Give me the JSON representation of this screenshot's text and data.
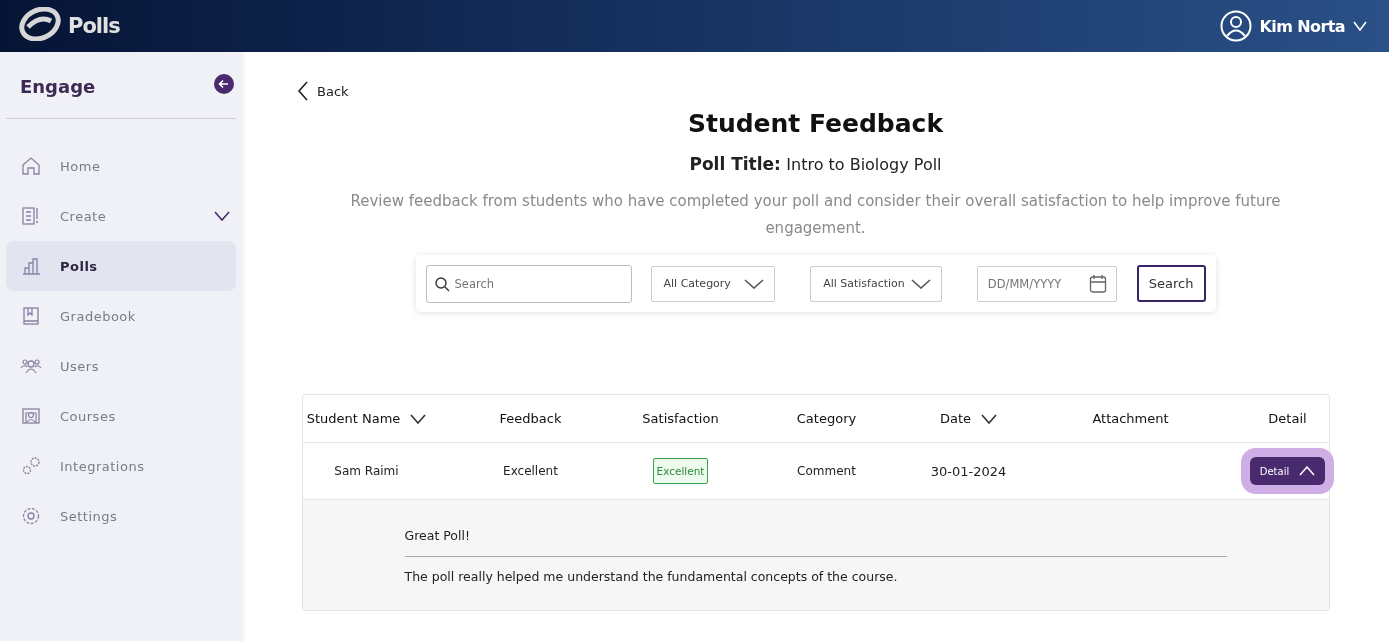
{
  "top_bar": {
    "brand": "Polls",
    "user": "Kim Norta"
  },
  "sidebar": {
    "title": "Engage",
    "items": [
      {
        "label": "Home",
        "selected": false
      },
      {
        "label": "Create",
        "selected": false,
        "expanded": false
      },
      {
        "label": "Polls",
        "selected": true
      },
      {
        "label": "Gradebook",
        "selected": false
      },
      {
        "label": "Users",
        "selected": false
      },
      {
        "label": "Courses",
        "selected": false
      },
      {
        "label": "Integrations",
        "selected": false
      },
      {
        "label": "Settings",
        "selected": false
      }
    ]
  },
  "back": "Back",
  "heading": "Student Feedback",
  "poll_title": {
    "label": "Poll Title:",
    "value": "Intro to Biology Poll"
  },
  "description": "Review feedback from students who have completed your poll and consider their overall satisfaction to help improve future engagement.",
  "filters": {
    "search": {
      "placeholder": "Search"
    },
    "category": "All Category",
    "satisfaction": "All Satisfaction",
    "date": {
      "placeholder": "DD/MM/YYYY"
    },
    "button": "Search"
  },
  "table": {
    "columns": [
      {
        "label": "Student Name",
        "sortable": true
      },
      {
        "label": "Feedback",
        "sortable": false
      },
      {
        "label": "Satisfaction",
        "sortable": false
      },
      {
        "label": "Category",
        "sortable": false
      },
      {
        "label": "Date",
        "sortable": true
      },
      {
        "label": "Attachment",
        "sortable": false
      },
      {
        "label": "Detail",
        "sortable": false
      }
    ],
    "rows": [
      {
        "student_name": "Sam Raimi",
        "feedback": "Excellent",
        "satisfaction": "Excellent",
        "category": "Comment",
        "date": "30-01-2024",
        "detail_button": "Detail",
        "expanded": true,
        "detail": {
          "title": "Great Poll!",
          "body": "The poll really helped me understand the fundamental concepts of the course."
        }
      }
    ]
  }
}
